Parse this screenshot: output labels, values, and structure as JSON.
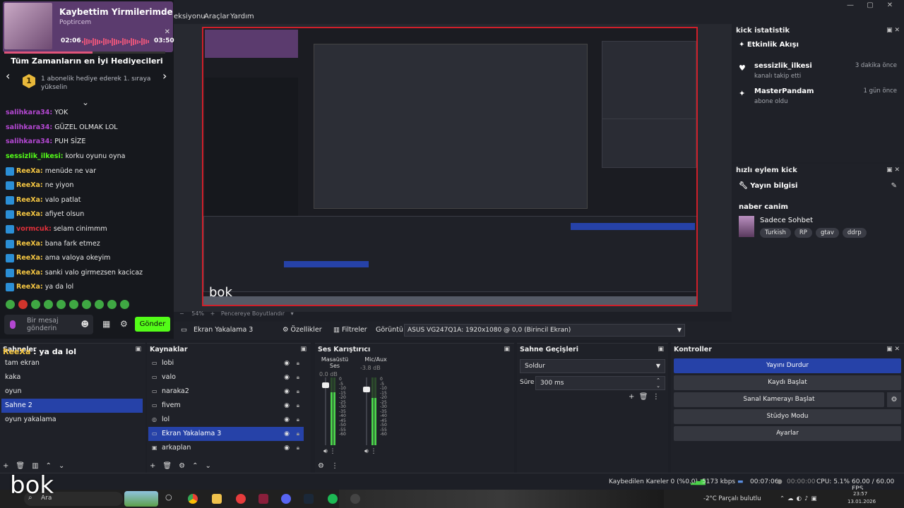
{
  "window": {
    "menu": [
      "eksiyonu",
      "Araçlar",
      "Yardım"
    ],
    "controls": [
      "—",
      "▢",
      "✕"
    ]
  },
  "now_playing": {
    "title": "Kaybettim Yirmilerimde",
    "artist": "Poptircem",
    "time_current": "02:06",
    "time_total": "03:50",
    "progress": 0.55
  },
  "gifts": {
    "title": "Tüm Zamanların en İyi Hediyecileri",
    "rank": "1",
    "text": "1 abonelik hediye ederek 1. sıraya yükselin"
  },
  "chat": {
    "messages": [
      {
        "user": "salihkara34",
        "msg": "YOK",
        "color": "#b347d1",
        "badge": false
      },
      {
        "user": "salihkara34",
        "msg": "GÜZEL OLMAK LOL",
        "color": "#b347d1",
        "badge": false
      },
      {
        "user": "salihkara34",
        "msg": "PUH SİZE",
        "color": "#b347d1",
        "badge": false
      },
      {
        "user": "sessizlik_ilkesi",
        "msg": "korku oyunu oyna",
        "color": "#53fc18",
        "badge": false
      },
      {
        "user": "ReeXa",
        "msg": "menüde ne var",
        "color": "#f5c642",
        "badge": true
      },
      {
        "user": "ReeXa",
        "msg": "ne yiyon",
        "color": "#f5c642",
        "badge": true
      },
      {
        "user": "ReeXa",
        "msg": "valo patlat",
        "color": "#f5c642",
        "badge": true
      },
      {
        "user": "ReeXa",
        "msg": "afiyet olsun",
        "color": "#f5c642",
        "badge": true
      },
      {
        "user": "vormcuk",
        "msg": "selam cinimmm",
        "color": "#e0303a",
        "badge": true
      },
      {
        "user": "ReeXa",
        "msg": "bana fark etmez",
        "color": "#f5c642",
        "badge": true
      },
      {
        "user": "ReeXa",
        "msg": "ama valoya okeyim",
        "color": "#f5c642",
        "badge": true
      },
      {
        "user": "ReeXa",
        "msg": "sanki valo girmezsen kacicaz",
        "color": "#f5c642",
        "badge": true
      },
      {
        "user": "ReeXa",
        "msg": "ya da lol",
        "color": "#f5c642",
        "badge": true
      }
    ],
    "input_placeholder": "Bir mesaj gönderin",
    "send_label": "Gönder"
  },
  "preview": {
    "overlay_text": "bok",
    "zoom": "54%",
    "fit_label": "Pencereye Boyutlandır"
  },
  "stats_dock": {
    "title": "kick istatistik",
    "activity_title": "Etkinlik Akışı",
    "events": [
      {
        "icon": "heart-icon",
        "name": "sessizlik_ilkesi",
        "sub": "kanalı takip etti",
        "time": "3 dakika önce"
      },
      {
        "icon": "sparkle-icon",
        "name": "MasterPandam",
        "sub": "abone oldu",
        "time": "1 gün önce"
      }
    ]
  },
  "quick_dock": {
    "title": "hızlı eylem kick",
    "info_title": "Yayın bilgisi",
    "stream_title": "naber canim",
    "category": "Sadece Sohbet",
    "tags": [
      "Turkish",
      "RP",
      "gtav",
      "ddrp"
    ]
  },
  "source_toolbar": {
    "source_name": "Ekran Yakalama 3",
    "properties": "Özellikler",
    "filters": "Filtreler",
    "display_label": "Görüntü",
    "display_value": "ASUS VG247Q1A: 1920x1080 @ 0,0 (Birincil Ekran)"
  },
  "scenes": {
    "title": "Sahneler",
    "overlay_user": "ReeXa",
    "overlay_msg": " : ya da lol",
    "items": [
      "tam ekran",
      "kaka",
      "oyun",
      "Sahne 2",
      "oyun yakalama"
    ],
    "selected": 3
  },
  "sources": {
    "title": "Kaynaklar",
    "items": [
      {
        "name": "lobi",
        "icon": "▭"
      },
      {
        "name": "valo",
        "icon": "▭"
      },
      {
        "name": "naraka2",
        "icon": "▭"
      },
      {
        "name": "fivem",
        "icon": "▭"
      },
      {
        "name": "lol",
        "icon": "◎"
      },
      {
        "name": "Ekran Yakalama 3",
        "icon": "▭"
      },
      {
        "name": "arkaplan",
        "icon": "▣"
      }
    ],
    "selected": 5
  },
  "mixer": {
    "title": "Ses Karıştırıcı",
    "channels": [
      {
        "name": "Masaüstü Ses",
        "db": "0.0 dB",
        "level": 0.78,
        "fader": 0.92
      },
      {
        "name": "Mic/Aux",
        "db": "-3.8 dB",
        "level": 0.7,
        "fader": 0.85
      }
    ],
    "scale": [
      "0",
      "-5",
      "-10",
      "-15",
      "-20",
      "-25",
      "-30",
      "-35",
      "-40",
      "-45",
      "-50",
      "-55",
      "-60"
    ]
  },
  "transitions": {
    "title": "Sahne Geçişleri",
    "type": "Soldur",
    "duration_label": "Süre",
    "duration": "300 ms"
  },
  "controls": {
    "title": "Kontroller",
    "buttons": [
      "Yayını Durdur",
      "Kaydı Başlat",
      "Sanal Kamerayı Başlat",
      "Stüdyo Modu",
      "Ayarlar"
    ]
  },
  "status": {
    "dropped": "Kaybedilen Kareler 0 (%0.0)",
    "bitrate": "5173 kbps",
    "stream_time": "00:07:06",
    "rec_time": "00:00:00",
    "cpu": "CPU: 5.1%",
    "fps": "60.00 / 60.00 FPS"
  },
  "taskbar": {
    "search": "Ara",
    "weather": "-2°C  Parçalı bulutlu",
    "time": "23:57",
    "date": "13.01.2026"
  },
  "bok_label": "bok"
}
